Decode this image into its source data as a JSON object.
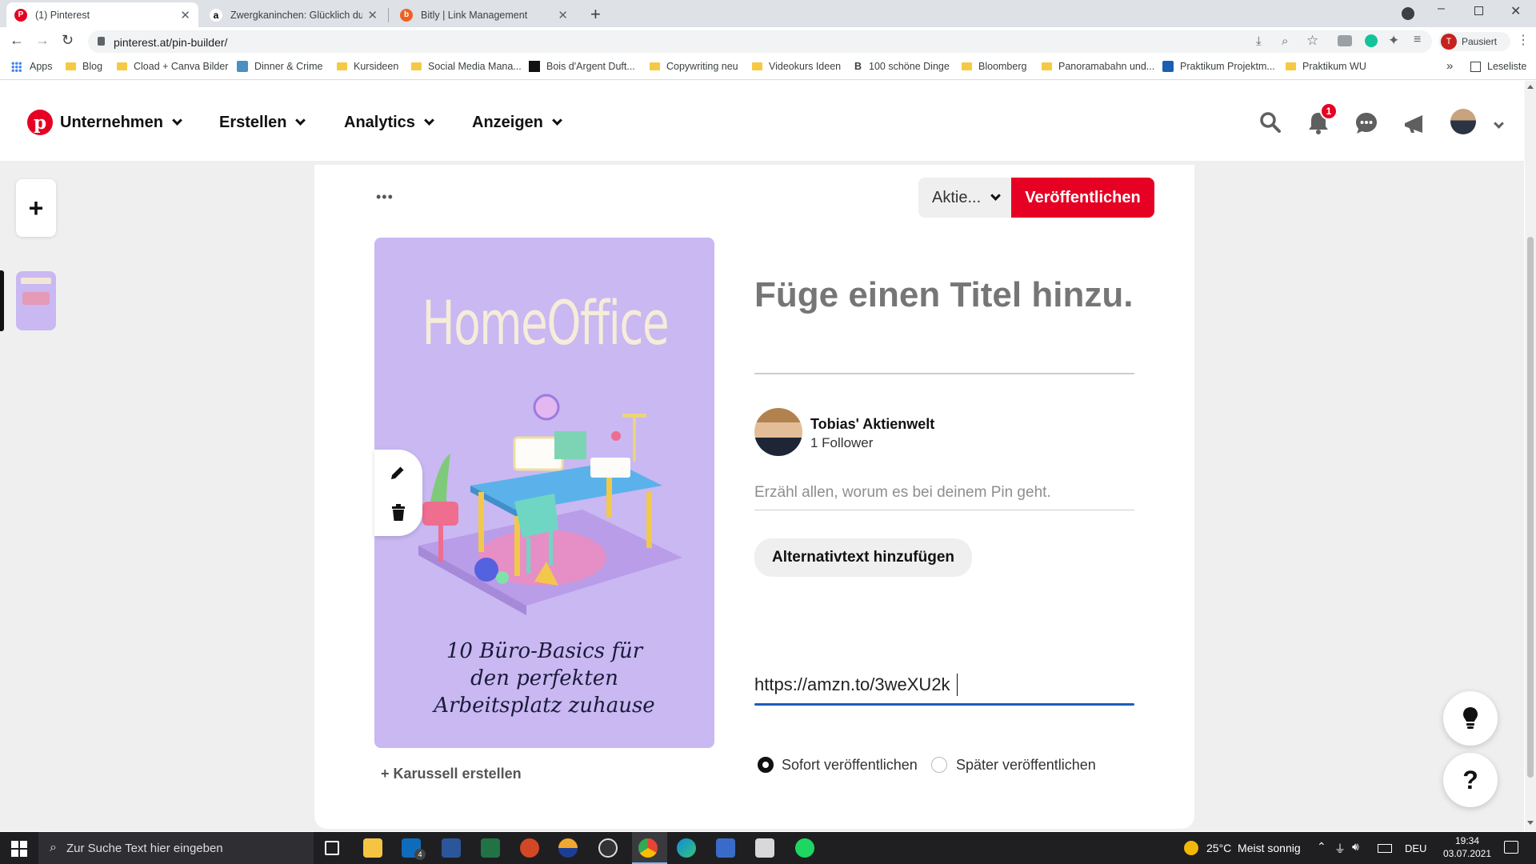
{
  "browser": {
    "tabs": [
      {
        "title": "(1) Pinterest",
        "active": true
      },
      {
        "title": "Zwergkaninchen: Glücklich durch",
        "active": false
      },
      {
        "title": "Bitly | Link Management",
        "active": false
      }
    ],
    "new_tab": "+",
    "url": "pinterest.at/pin-builder/",
    "profile_status": "Pausiert",
    "profile_initial": "T",
    "bookmarks": [
      "Apps",
      "Blog",
      "Cload + Canva Bilder",
      "Dinner & Crime",
      "Kursideen",
      "Social Media Mana...",
      "Bois d'Argent Duft...",
      "Copywriting neu",
      "Videokurs Ideen",
      "100 schöne Dinge",
      "Bloomberg",
      "Panoramabahn und...",
      "Praktikum Projektm...",
      "Praktikum WU"
    ],
    "reading_list": "Leseliste",
    "more_bookmarks": "»"
  },
  "header": {
    "nav": [
      "Unternehmen",
      "Erstellen",
      "Analytics",
      "Anzeigen"
    ],
    "notification_count": "1",
    "brand_color": "#e60023"
  },
  "sidebar": {
    "add": "+"
  },
  "pin_builder": {
    "more": "•••",
    "board_select": "Aktie...",
    "publish_label": "Veröffentlichen",
    "image": {
      "title": "HomeOffice",
      "caption_lines": [
        "10 Büro-Basics für",
        "den perfekten",
        "Arbeitsplatz zuhause"
      ],
      "bg_color": "#c9b8f2"
    },
    "carousel_label": "+ Karussell erstellen",
    "title_placeholder": "Füge einen Titel hinzu.",
    "author": {
      "name": "Tobias' Aktienwelt",
      "followers": "1 Follower"
    },
    "description_placeholder": "Erzähl allen, worum es bei deinem Pin geht.",
    "alt_text_label": "Alternativtext hinzufügen",
    "link_value": "https://amzn.to/3weXU2k",
    "publish_options": [
      {
        "label": "Sofort veröffentlichen",
        "selected": true
      },
      {
        "label": "Später veröffentlichen",
        "selected": false
      }
    ],
    "help": "?"
  },
  "taskbar": {
    "search_placeholder": "Zur Suche Text hier eingeben",
    "mail_badge": "4",
    "weather": "25°C  Meist sonnig",
    "lang": "DEU",
    "time": "19:34",
    "date": "03.07.2021"
  }
}
